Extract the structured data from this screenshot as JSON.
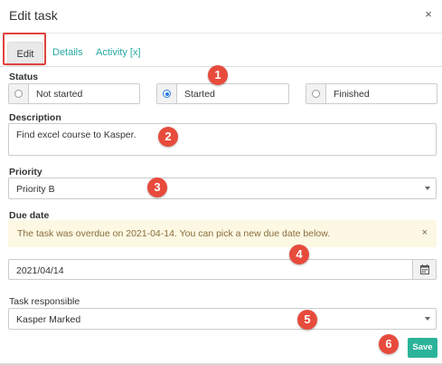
{
  "dialog": {
    "title": "Edit task",
    "close_symbol": "×"
  },
  "tabs": [
    {
      "label": "Edit",
      "active": true
    },
    {
      "label": "Details",
      "active": false
    },
    {
      "label": "Activity [x]",
      "active": false
    }
  ],
  "status": {
    "label": "Status",
    "options": [
      {
        "label": "Not started",
        "selected": false
      },
      {
        "label": "Started",
        "selected": true
      },
      {
        "label": "Finished",
        "selected": false
      }
    ]
  },
  "description": {
    "label": "Description",
    "value": "Find excel course to Kasper."
  },
  "priority": {
    "label": "Priority",
    "value": "Priority B"
  },
  "due_date": {
    "label": "Due date",
    "alert": "The task was overdue on 2021-04-14. You can pick a new due date below.",
    "alert_close": "×",
    "value": "2021/04/14"
  },
  "responsible": {
    "label": "Task responsible",
    "value": "Kasper Marked"
  },
  "save_label": "Save",
  "markers": [
    "1",
    "2",
    "3",
    "4",
    "5",
    "6"
  ],
  "colors": {
    "accent": "#27a8a2",
    "save": "#2bb39a",
    "marker": "#e74b3c",
    "alert_bg": "#fcf8e3"
  }
}
